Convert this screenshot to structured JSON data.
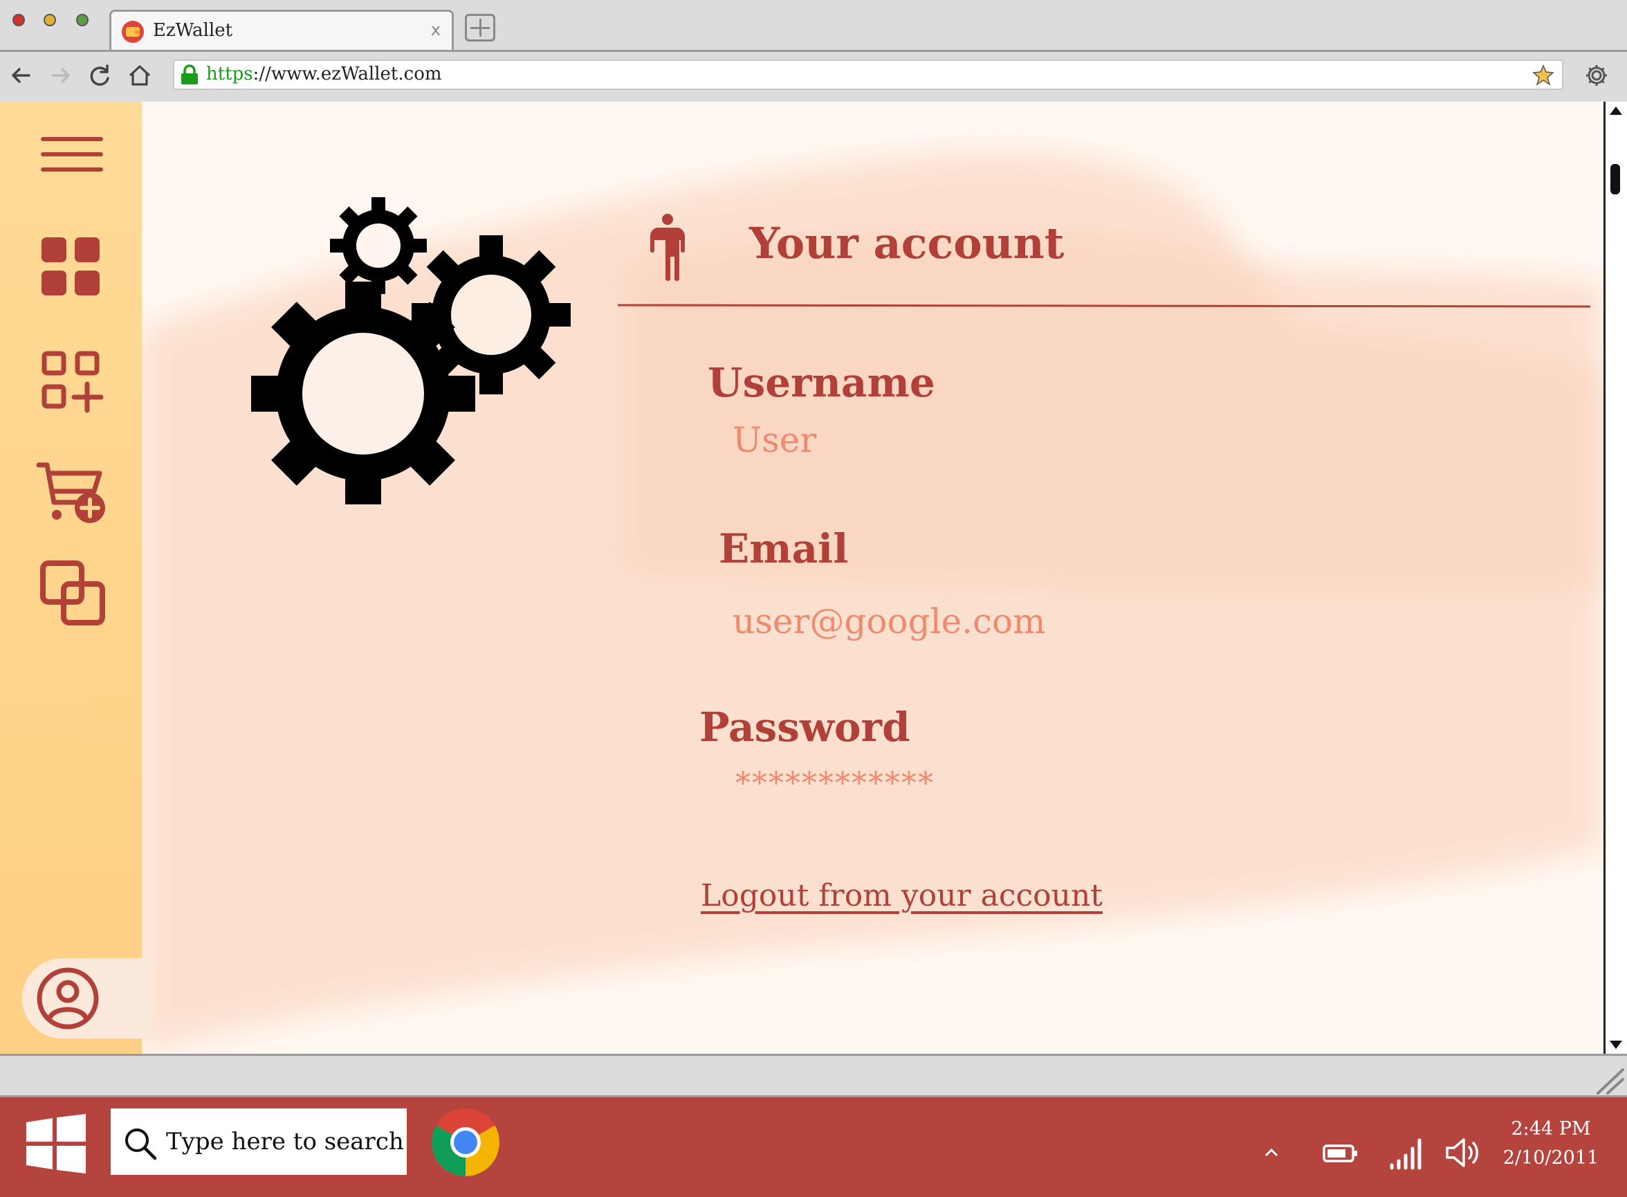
{
  "browser": {
    "tab_title": "EzWallet",
    "tab_close": "x",
    "url_scheme": "https",
    "url_rest": "://www.ezWallet.com"
  },
  "sidebar": {
    "items": [
      {
        "name": "menu",
        "icon": "hamburger-menu-icon"
      },
      {
        "name": "dashboard",
        "icon": "grid-icon"
      },
      {
        "name": "add-category",
        "icon": "grid-add-icon"
      },
      {
        "name": "add-transaction",
        "icon": "cart-add-icon"
      },
      {
        "name": "groups",
        "icon": "overlapping-squares-icon"
      },
      {
        "name": "account",
        "icon": "user-circle-icon"
      }
    ]
  },
  "account": {
    "heading": "Your account",
    "username_label": "Username",
    "username_value": "User",
    "email_label": "Email",
    "email_value": "user@google.com",
    "password_label": "Password",
    "password_value": "************",
    "logout_label": "Logout from your account"
  },
  "taskbar": {
    "search_placeholder": "Type here to search",
    "time": "2:44 PM",
    "date": "2/10/2011"
  },
  "colors": {
    "accent": "#b14038",
    "value_text": "#ef8a6e",
    "sidebar": "#ffd58c",
    "taskbar": "#b5443f",
    "page_bg": "#fff8f2"
  }
}
